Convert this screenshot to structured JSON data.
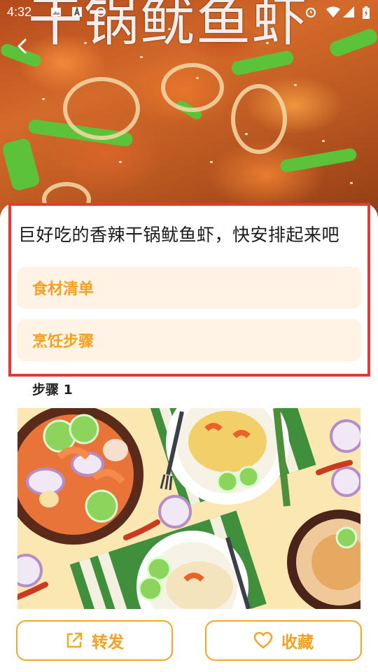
{
  "status_bar": {
    "time": "4:32"
  },
  "hero": {
    "overlay_title": "干锅鱿鱼虾"
  },
  "recipe": {
    "title": "巨好吃的香辣干锅鱿鱼虾，快安排起来吧",
    "sections": [
      {
        "label": "食材清单"
      },
      {
        "label": "烹饪步骤"
      }
    ],
    "step": {
      "label": "步骤 1"
    }
  },
  "actions": {
    "share_label": "转发",
    "favorite_label": "收藏"
  },
  "colors": {
    "accent": "#f5a623",
    "section_bg": "#fff3e6",
    "highlight_border": "#e53935"
  }
}
